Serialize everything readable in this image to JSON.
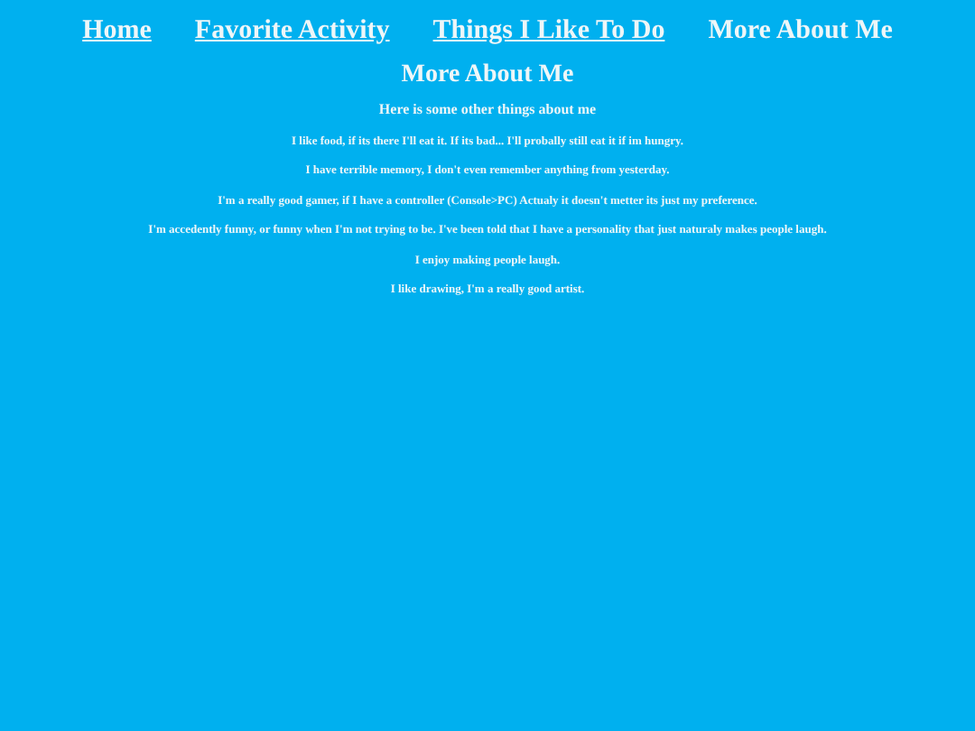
{
  "nav": [
    {
      "label": "Home",
      "selected": false
    },
    {
      "label": "Favorite Activity",
      "selected": false
    },
    {
      "label": "Things I Like To Do",
      "selected": false
    },
    {
      "label": "More About Me",
      "selected": true
    }
  ],
  "heading": "More About Me",
  "subheading": "Here is some other things about me",
  "paragraphs": [
    "I like food, if its there I'll eat it. If its bad... I'll probally still eat it if im hungry.",
    "I have terrible memory, I don't even remember anything from yesterday.",
    "I'm a really good gamer, if I have a controller (Console>PC) Actualy it doesn't metter its just my preference.",
    "I'm accedently funny, or funny when I'm not trying to be. I've been told that I have a personality that just naturaly makes people laugh.",
    "I enjoy making people laugh.",
    "I like drawing, I'm a really good artist."
  ]
}
